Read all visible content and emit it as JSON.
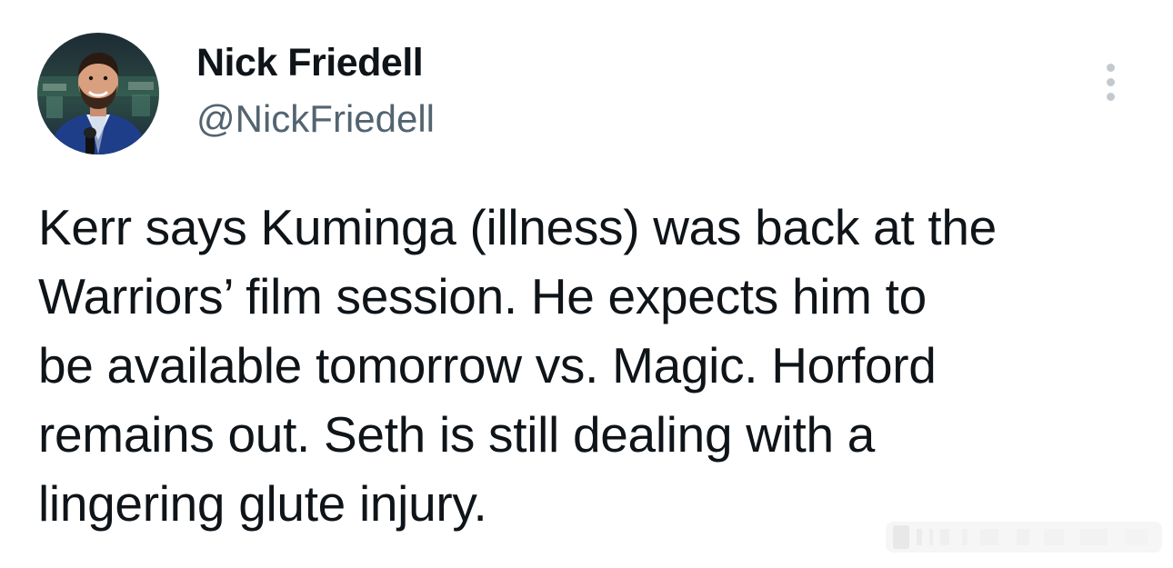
{
  "tweet": {
    "author": {
      "display_name": "Nick Friedell",
      "handle": "@NickFriedell",
      "avatar_icon": "profile-photo"
    },
    "more_icon": "more-options-icon",
    "text": "Kerr says Kuminga (illness) was back at the\nWarriors’ film session. He expects him to\nbe available tomorrow vs. Magic. Horford\nremains out. Seth is still dealing with a\nlingering glute injury."
  },
  "colors": {
    "text_primary": "#0f1419",
    "text_secondary": "#536471",
    "more_dots": "#c4c9ce",
    "background": "#ffffff"
  }
}
